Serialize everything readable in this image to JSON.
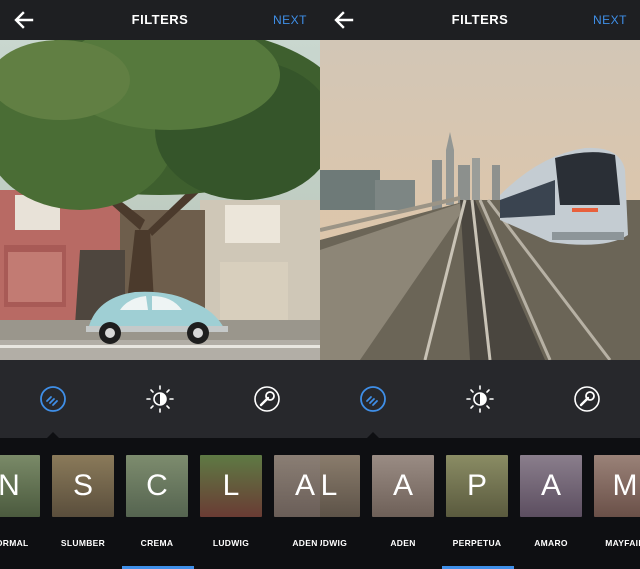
{
  "colors": {
    "accent": "#3f8fe8",
    "bar": "#1e1f22",
    "panel": "#27282c",
    "strip": "#0e0f12"
  },
  "screens": [
    {
      "header": {
        "back_icon": "back-arrow-icon",
        "title": "FILTERS",
        "next_label": "NEXT"
      },
      "photo": {
        "subject": "Tree and car photo"
      },
      "tools": [
        "filter-icon",
        "lux-icon",
        "edit-wrench-icon"
      ],
      "filters": [
        {
          "letter": "N",
          "label": "NORMAL"
        },
        {
          "letter": "S",
          "label": "SLUMBER"
        },
        {
          "letter": "C",
          "label": "CREMA"
        },
        {
          "letter": "L",
          "label": "LUDWIG"
        },
        {
          "letter": "A",
          "label": "ADEN"
        }
      ]
    },
    {
      "header": {
        "back_icon": "back-arrow-icon",
        "title": "FILTERS",
        "next_label": "NEXT"
      },
      "photo": {
        "subject": "Train photo"
      },
      "tools": [
        "filter-icon",
        "lux-icon",
        "edit-wrench-icon"
      ],
      "filters": [
        {
          "letter": "L",
          "label": "LUDWIG"
        },
        {
          "letter": "A",
          "label": "ADEN"
        },
        {
          "letter": "P",
          "label": "PERPETUA"
        },
        {
          "letter": "A",
          "label": "AMARO"
        },
        {
          "letter": "M",
          "label": "MAYFAIR"
        }
      ]
    }
  ]
}
